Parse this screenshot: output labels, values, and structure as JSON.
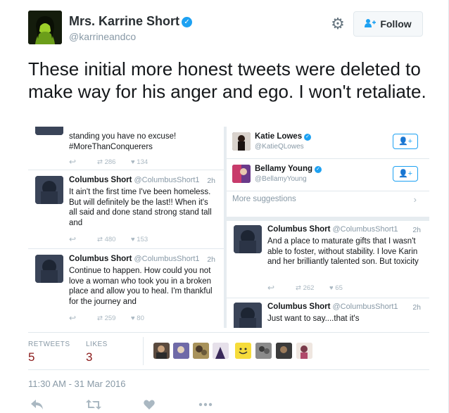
{
  "author": {
    "name": "Mrs. Karrine Short",
    "handle": "@karrineandco",
    "verified": true
  },
  "follow_button": {
    "label": "Follow",
    "icon": "person-plus-icon"
  },
  "settings_icon": "gear-icon",
  "tweet_text": "These initial more honest tweets were deleted to make way for his anger and ego. I won't retaliate.",
  "media": {
    "left_column": [
      {
        "body": "standing you have no excuse! #MoreThanConquerers",
        "retweets": "286",
        "likes": "134"
      },
      {
        "name": "Columbus Short",
        "handle": "@ColumbusShort1",
        "time": "2h",
        "body": "It ain't the first time I've been homeless. But will definitely be the last!! When it's all said and done stand strong stand tall and",
        "retweets": "480",
        "likes": "153"
      },
      {
        "name": "Columbus Short",
        "handle": "@ColumbusShort1",
        "time": "2h",
        "body": "Continue to happen. How could you not love a woman who took you in a broken place and allow you to heal. I'm thankful for the journey and",
        "retweets": "259",
        "likes": "80"
      }
    ],
    "suggestions": [
      {
        "name": "Katie Lowes",
        "handle": "@KatieQLowes"
      },
      {
        "name": "Bellamy Young",
        "handle": "@BellamyYoung"
      }
    ],
    "more_suggestions": "More suggestions",
    "right_column": [
      {
        "name": "Columbus Short",
        "handle": "@ColumbusShort1",
        "time": "2h",
        "body": "And a place to maturate gifts that I wasn't able to foster, without stability. I love Karin and her brilliantly talented son. But toxicity",
        "retweets": "262",
        "likes": "65"
      },
      {
        "name": "Columbus Short",
        "handle": "@ColumbusShort1",
        "time": "2h",
        "body": "Just want to say....that it's"
      }
    ]
  },
  "stats": {
    "retweets_label": "RETWEETS",
    "retweets_value": "5",
    "likes_label": "LIKES",
    "likes_value": "3"
  },
  "timestamp": "11:30 AM - 31 Mar 2016",
  "actions": [
    "reply-icon",
    "retweet-icon",
    "like-icon",
    "more-icon"
  ],
  "colors": {
    "accent": "#1da1f2",
    "stat_value": "#8b1a1a",
    "muted": "#8899a6"
  }
}
